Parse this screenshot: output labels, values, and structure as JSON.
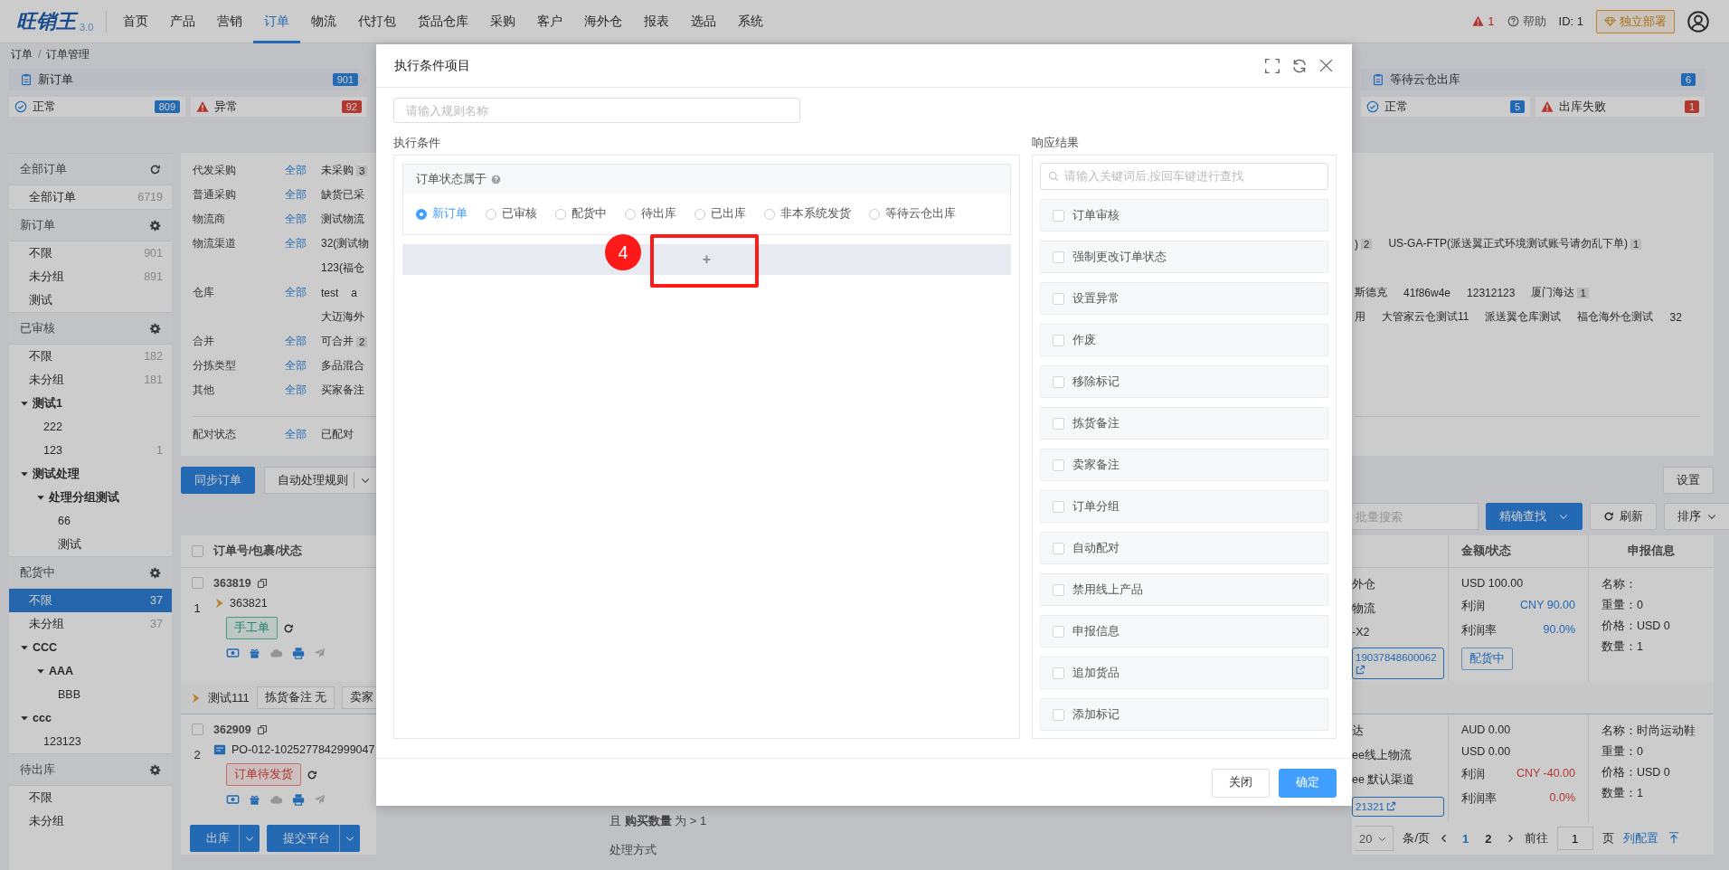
{
  "nav": {
    "logo": "旺销王",
    "version": "3.0",
    "items": [
      {
        "label": "首页",
        "selected": false
      },
      {
        "label": "产品",
        "selected": false
      },
      {
        "label": "营销",
        "selected": false
      },
      {
        "label": "订单",
        "selected": true
      },
      {
        "label": "物流",
        "selected": false
      },
      {
        "label": "代打包",
        "selected": false
      },
      {
        "label": "货品仓库",
        "selected": false
      },
      {
        "label": "采购",
        "selected": false
      },
      {
        "label": "客户",
        "selected": false
      },
      {
        "label": "海外仓",
        "selected": false
      },
      {
        "label": "报表",
        "selected": false
      },
      {
        "label": "选品",
        "selected": false
      },
      {
        "label": "系统",
        "selected": false
      }
    ],
    "alert_count": "1",
    "help": "帮助",
    "user_id": "ID: 1",
    "deploy_button": "独立部署"
  },
  "breadcrumb": {
    "items": [
      "订单",
      "订单管理"
    ],
    "separator": "/"
  },
  "status_tabs": {
    "left": [
      {
        "label": "新订单",
        "count": "901"
      }
    ],
    "right": [
      {
        "label": "等待云仓出库",
        "count": "6"
      }
    ]
  },
  "substatus": {
    "left": [
      {
        "label": "正常",
        "count": "809",
        "kind": "ok"
      },
      {
        "label": "异常",
        "count": "92",
        "kind": "error"
      }
    ],
    "right": [
      {
        "label": "正常",
        "count": "5",
        "kind": "ok"
      },
      {
        "label": "出库失败",
        "count": "1",
        "kind": "error"
      }
    ]
  },
  "sidebar": {
    "groups": [
      {
        "title": "全部订单",
        "items": [
          {
            "label": "全部订单",
            "count": "6719",
            "selected": false
          }
        ]
      },
      {
        "title": "新订单",
        "items": [
          {
            "label": "不限",
            "count": "901",
            "selected": false
          },
          {
            "label": "未分组",
            "count": "891",
            "selected": false
          },
          {
            "label": "测试",
            "selected": false
          }
        ]
      },
      {
        "title": "已审核",
        "items": [
          {
            "label": "不限",
            "count": "182",
            "selected": false
          },
          {
            "label": "未分组",
            "count": "181",
            "selected": false
          },
          {
            "label": "测试1",
            "selected": false,
            "expanded": true,
            "children": [
              {
                "label": "222",
                "selected": false
              },
              {
                "label": "123",
                "count": "1",
                "selected": false
              }
            ]
          },
          {
            "label": "测试处理",
            "selected": false,
            "expanded": true,
            "children": [
              {
                "label": "处理分组测试",
                "selected": false,
                "expanded": true,
                "children": [
                  {
                    "label": "66",
                    "selected": false
                  },
                  {
                    "label": "测试",
                    "selected": false
                  }
                ]
              }
            ]
          }
        ]
      },
      {
        "title": "配货中",
        "items": [
          {
            "label": "不限",
            "count": "37",
            "selected": true
          },
          {
            "label": "未分组",
            "count": "37",
            "selected": false
          },
          {
            "label": "CCC",
            "selected": false,
            "expanded": true,
            "children": [
              {
                "label": "AAA",
                "selected": false,
                "expanded": true,
                "children": [
                  {
                    "label": "BBB",
                    "selected": false
                  }
                ]
              }
            ]
          },
          {
            "label": "ccc",
            "selected": false,
            "expanded": true,
            "children": [
              {
                "label": "123123",
                "selected": false
              }
            ]
          }
        ]
      },
      {
        "title": "待出库",
        "items": [
          {
            "label": "不限",
            "selected": false
          },
          {
            "label": "未分组",
            "selected": false
          }
        ]
      }
    ]
  },
  "filters": {
    "rows": [
      {
        "label": "代发采购",
        "all": "全部",
        "left": [
          {
            "text": "未采购",
            "count": "3"
          }
        ]
      },
      {
        "label": "普通采购",
        "all": "全部",
        "left": [
          {
            "text": "缺货已采"
          }
        ]
      },
      {
        "label": "物流商",
        "all": "全部",
        "left": [
          {
            "text": "测试物流"
          }
        ]
      },
      {
        "label": "物流渠道",
        "all": "全部",
        "left": [
          {
            "text": "32(测试物"
          }
        ],
        "right": [
          {
            "text": ")",
            "count": "2"
          },
          {
            "text": "US-GA-FTP(派送翼正式环境测试账号请勿乱下单)",
            "count": "1"
          }
        ]
      },
      {
        "left": [
          {
            "text": "123(福仓"
          }
        ]
      },
      {
        "label": "仓库",
        "all": "全部",
        "left": [
          {
            "text": "test"
          },
          {
            "text": "a"
          }
        ],
        "right": [
          {
            "text": "斯德克"
          },
          {
            "text": "41f86w4e"
          },
          {
            "text": "12312123"
          },
          {
            "text": "厦门海达",
            "count": "1"
          }
        ]
      },
      {
        "left": [
          {
            "text": "大迈海外"
          }
        ],
        "right": [
          {
            "text": "用"
          },
          {
            "text": "大管家云仓测试11"
          },
          {
            "text": "派送翼仓库测试"
          },
          {
            "text": "福仓海外仓测试"
          },
          {
            "text": "32"
          }
        ]
      },
      {
        "label": "合并",
        "all": "全部",
        "left": [
          {
            "text": "可合并",
            "count": "2"
          }
        ]
      },
      {
        "label": "分拣类型",
        "all": "全部",
        "left": [
          {
            "text": "多品混合"
          }
        ]
      },
      {
        "label": "其他",
        "all": "全部",
        "left": [
          {
            "text": "买家备注"
          }
        ]
      }
    ],
    "pair_row": {
      "label": "配对状态",
      "all": "全部",
      "left": [
        {
          "text": "已配对"
        }
      ]
    }
  },
  "toolbar": {
    "left": [
      {
        "label": "同步订单",
        "kind": "primary"
      },
      {
        "label": "自动处理规则",
        "kind": "split"
      }
    ],
    "right": [
      {
        "label": "设置",
        "kind": "default"
      }
    ]
  },
  "search_bar": {
    "placeholder": "批量搜索",
    "buttons": [
      {
        "label": "精确查找",
        "kind": "split-primary"
      },
      {
        "label": "刷新",
        "kind": "refresh"
      },
      {
        "label": "排序",
        "kind": "sort"
      }
    ]
  },
  "table": {
    "select_all_checked": false,
    "left_columns": [
      "订单号/包裹/状态"
    ],
    "right_columns": [
      "金额/状态",
      "申报信息"
    ],
    "orders": [
      {
        "checked": false,
        "id": "363819",
        "index": "1",
        "package": {
          "kind": "flag",
          "text": "363821"
        },
        "tag": {
          "text": "手工单",
          "kind": "success"
        },
        "logistics": [
          "外仓",
          "物流",
          "-X2"
        ],
        "tracking": "19037848600062",
        "amounts": [
          {
            "text": "USD 100.00"
          },
          {
            "label": "利润",
            "text": "CNY 90.00",
            "kind": "gain"
          },
          {
            "label": "利润率",
            "text": "90.0%",
            "kind": "gain"
          }
        ],
        "status": "配货中",
        "declaration": [
          "名称：",
          "重量：0",
          "价格：USD 0",
          "数量：1"
        ]
      },
      {
        "group_header": {
          "text": "测试111",
          "tags": [
            "拣货备注 无",
            "卖家"
          ]
        },
        "checked": false,
        "id": "362909",
        "index": "2",
        "package": {
          "kind": "platform",
          "text": "PO-012-1025277842999047"
        },
        "tag": {
          "text": "订单待发货",
          "kind": "danger"
        },
        "logistics": [
          "达",
          "ee线上物流",
          "ee 默认渠道"
        ],
        "tracking": "21321",
        "amounts": [
          {
            "text": "AUD 0.00"
          },
          {
            "text": "USD 0.00"
          },
          {
            "label": "利润",
            "text": "CNY -40.00",
            "kind": "loss"
          },
          {
            "label": "利润率",
            "text": "0.0%",
            "kind": "loss"
          }
        ],
        "declaration": [
          "名称：时尚运动鞋",
          "重量：0",
          "价格：USD 0",
          "数量：1"
        ]
      }
    ]
  },
  "rule_preview": [
    "且 **购买数量** 为 > 1",
    "处理方式"
  ],
  "bottom_bar": {
    "buttons": [
      "出库",
      "提交平台"
    ],
    "pagination": {
      "page_size": "20",
      "per_page": "条/页",
      "pages": [
        {
          "label": "1",
          "selected": true
        },
        {
          "label": "2",
          "selected": false
        }
      ],
      "goto": "前往",
      "goto_value": "1",
      "page_unit": "页",
      "columns_link": "列配置"
    }
  },
  "modal": {
    "title": "执行条件项目",
    "rule_name_placeholder": "请输入规则名称",
    "conditions_label": "执行条件",
    "condition": {
      "title": "订单状态属于",
      "options": [
        {
          "label": "新订单",
          "selected": true
        },
        {
          "label": "已审核",
          "selected": false
        },
        {
          "label": "配货中",
          "selected": false
        },
        {
          "label": "待出库",
          "selected": false
        },
        {
          "label": "已出库",
          "selected": false
        },
        {
          "label": "非本系统发货",
          "selected": false
        },
        {
          "label": "等待云仓出库",
          "selected": false
        }
      ]
    },
    "add_button": "+",
    "annotation": {
      "step": "4"
    },
    "results_label": "响应结果",
    "results_search_placeholder": "请输入关键词后,按回车键进行查找",
    "results": [
      {
        "label": "订单审核",
        "checked": false
      },
      {
        "label": "强制更改订单状态",
        "checked": false
      },
      {
        "label": "设置异常",
        "checked": false
      },
      {
        "label": "作废",
        "checked": false
      },
      {
        "label": "移除标记",
        "checked": false
      },
      {
        "label": "拣货备注",
        "checked": false
      },
      {
        "label": "卖家备注",
        "checked": false
      },
      {
        "label": "订单分组",
        "checked": false
      },
      {
        "label": "自动配对",
        "checked": false
      },
      {
        "label": "禁用线上产品",
        "checked": false
      },
      {
        "label": "申报信息",
        "checked": false
      },
      {
        "label": "追加货品",
        "checked": false
      },
      {
        "label": "添加标记",
        "checked": false
      }
    ],
    "buttons": {
      "cancel": "关闭",
      "confirm": "确定"
    }
  }
}
